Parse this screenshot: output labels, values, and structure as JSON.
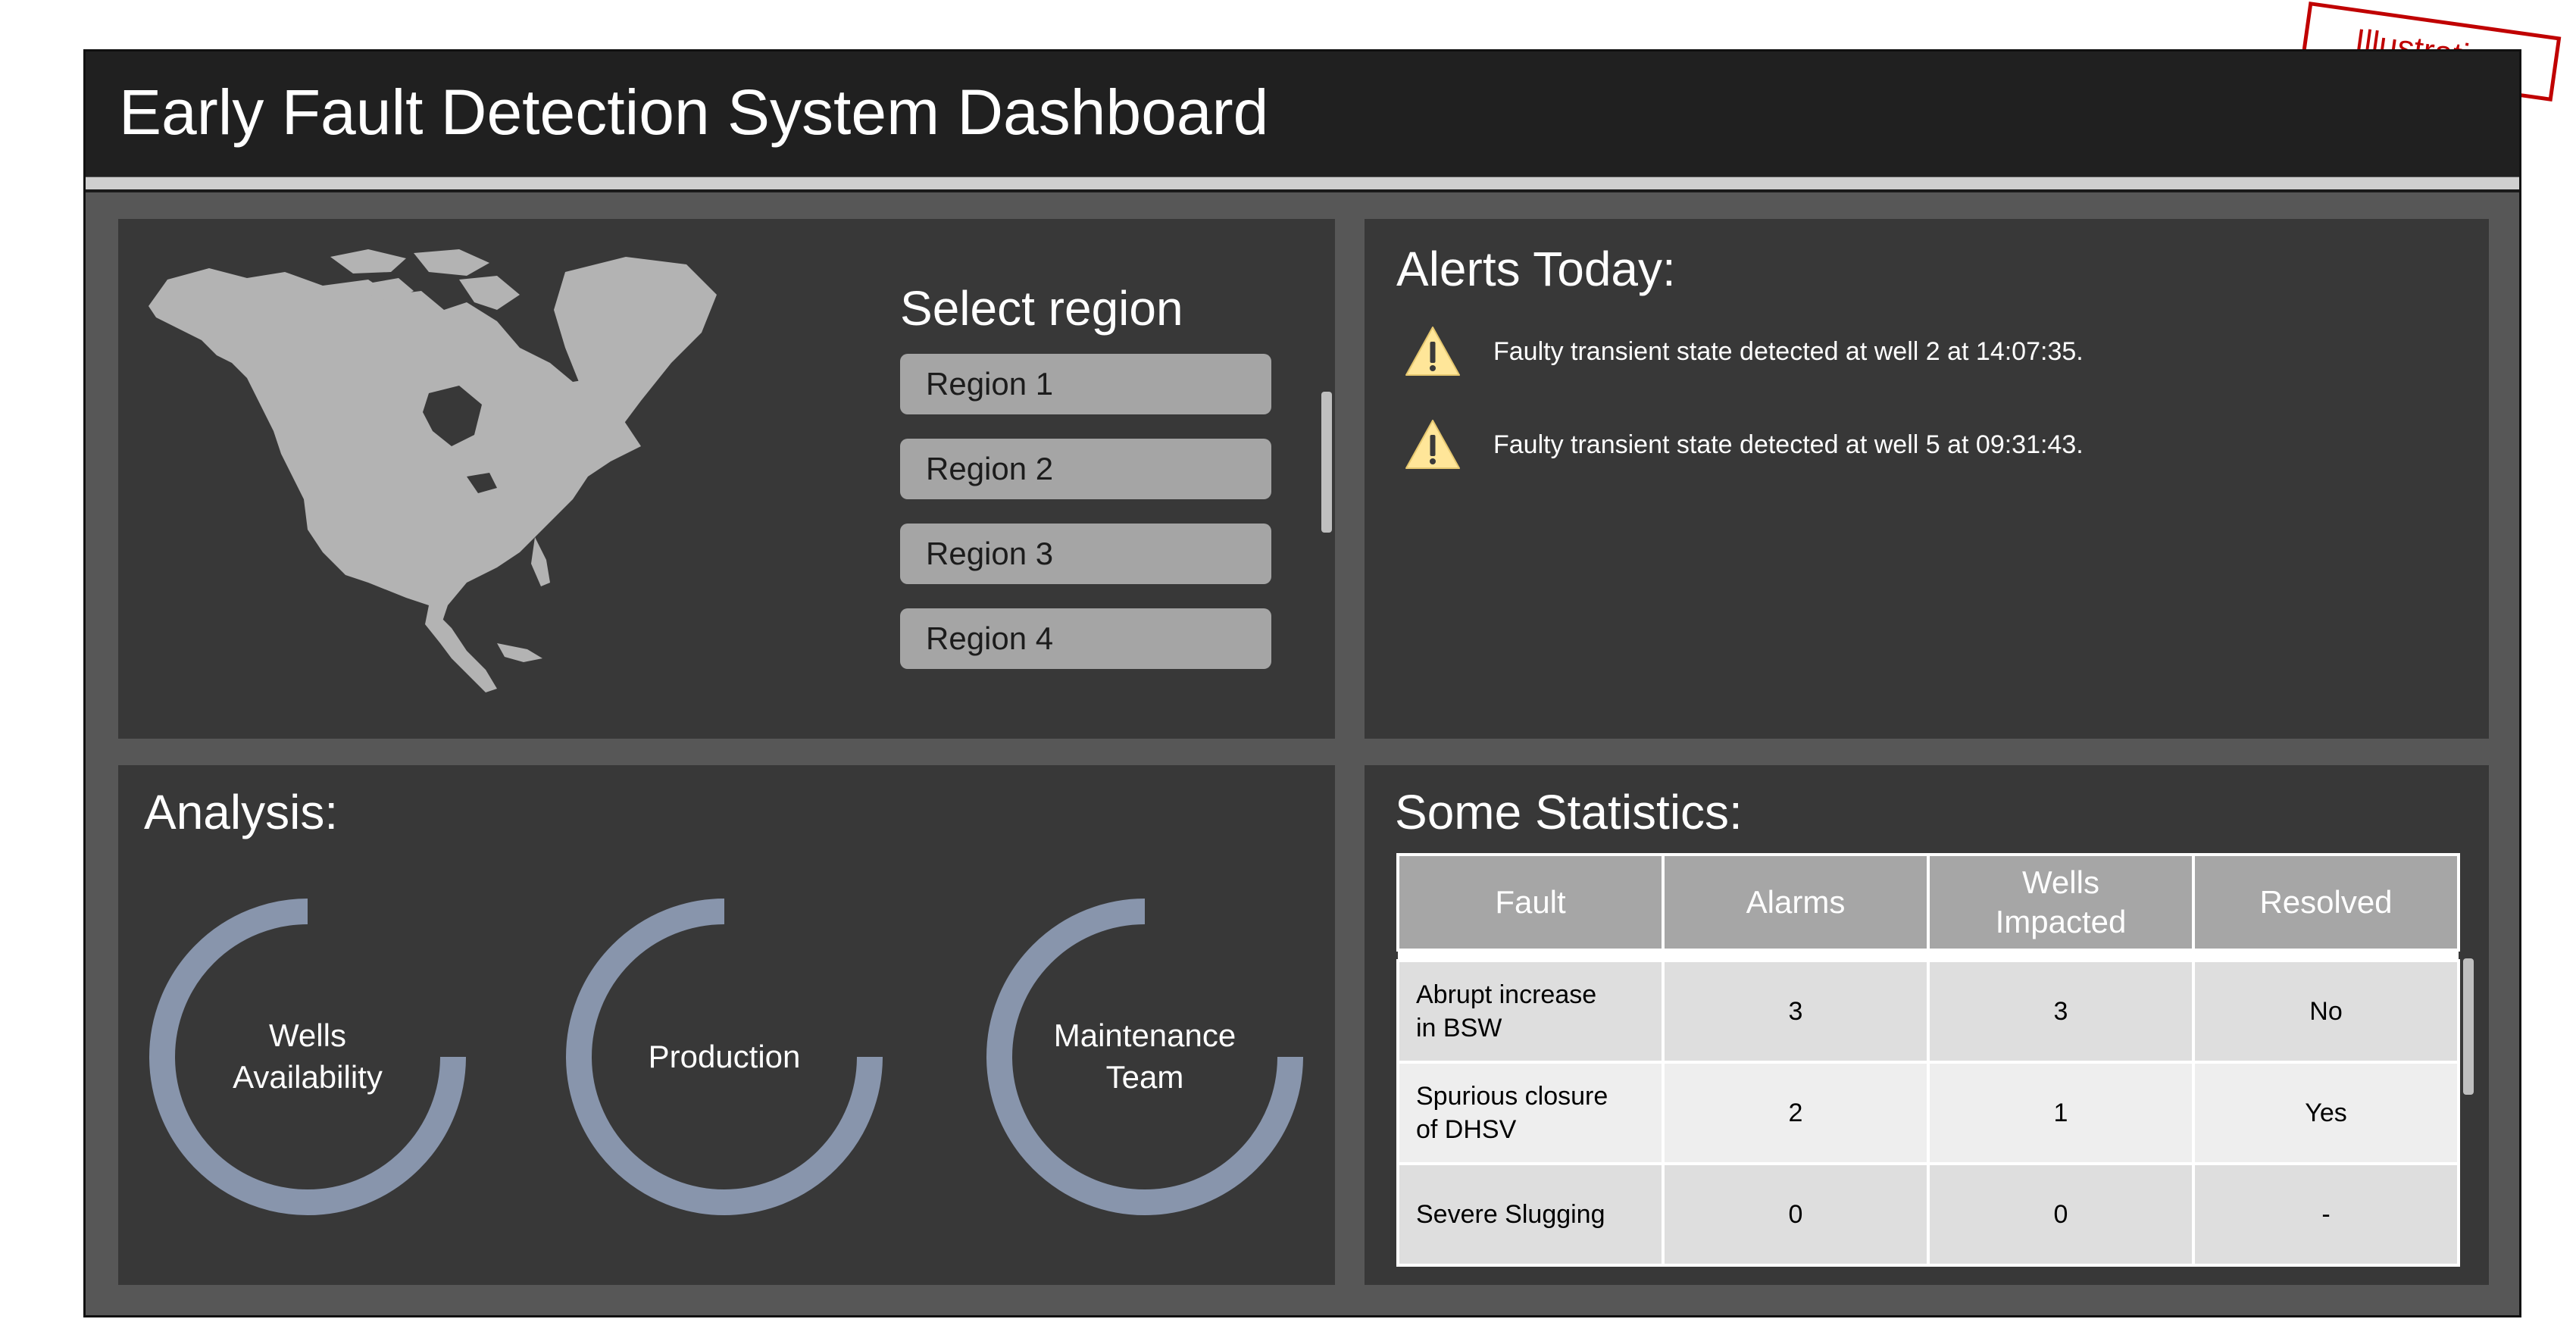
{
  "header": {
    "title": "Early Fault Detection System Dashboard"
  },
  "stamp": {
    "label": "Illustration",
    "color": "#c00000"
  },
  "map_panel": {
    "title": "Select region",
    "regions": [
      "Region 1",
      "Region 2",
      "Region 3",
      "Region 4"
    ]
  },
  "alerts": {
    "title": "Alerts Today:",
    "items": [
      {
        "prefix": "Faulty transient state detected at ",
        "well": "well 2",
        "mid": " at ",
        "time": "14:07:35",
        "suffix": "."
      },
      {
        "prefix": "Faulty transient state detected at ",
        "well": "well 5",
        "mid": " at ",
        "time": "09:31:43",
        "suffix": "."
      }
    ],
    "icon": "warning-icon"
  },
  "analysis": {
    "title": "Analysis:",
    "gauges": [
      {
        "line1": "Wells",
        "line2": "Availability"
      },
      {
        "line1": "Production",
        "line2": ""
      },
      {
        "line1": "Maintenance",
        "line2": "Team"
      }
    ],
    "gauge_color": "#8895ac"
  },
  "stats": {
    "title": "Some Statistics:",
    "headers": [
      "Fault",
      "Alarms",
      "Wells Impacted",
      "Resolved"
    ],
    "header_lines": [
      [
        "Fault"
      ],
      [
        "Alarms"
      ],
      [
        "Wells",
        "Impacted"
      ],
      [
        "Resolved"
      ]
    ],
    "rows": [
      {
        "fault": [
          "Abrupt increase",
          "in BSW"
        ],
        "alarms": "3",
        "wells": "3",
        "resolved": "No"
      },
      {
        "fault": [
          "Spurious closure",
          "of DHSV"
        ],
        "alarms": "2",
        "wells": "1",
        "resolved": "Yes"
      },
      {
        "fault": [
          "Severe Slugging"
        ],
        "alarms": "0",
        "wells": "0",
        "resolved": "-"
      }
    ]
  },
  "colors": {
    "background": "#575757",
    "header": "#202020",
    "panel": "#383838",
    "button": "#a5a5a5",
    "table_header": "#a6a6a6",
    "warning": "#ffe699"
  }
}
